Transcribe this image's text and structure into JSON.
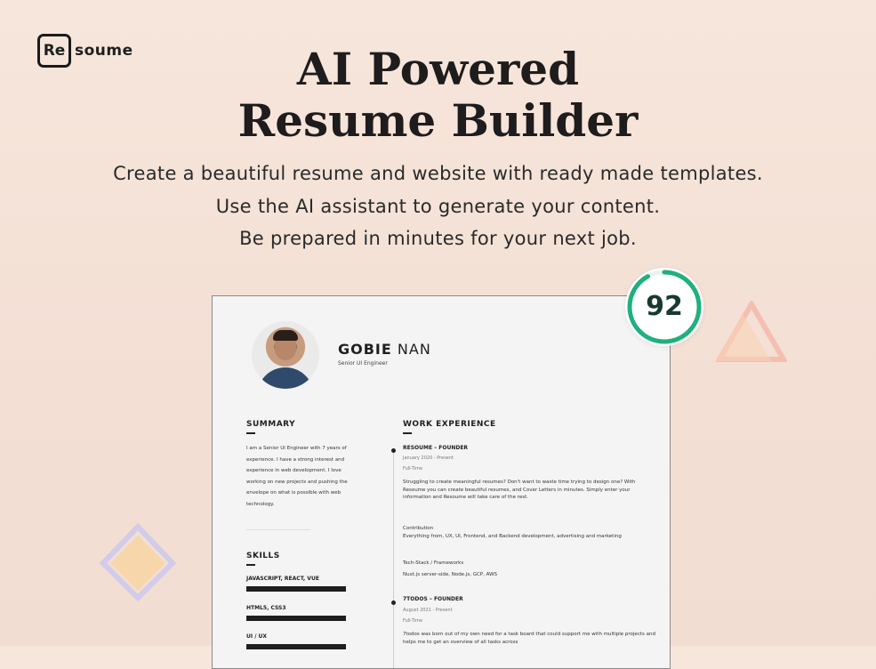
{
  "brand": {
    "logo_box": "Re",
    "logo_rest": "soume"
  },
  "hero": {
    "title_line1": "AI Powered",
    "title_line2": "Resume Builder",
    "sub_line1": "Create a beautiful resume and website with ready made templates.",
    "sub_line2": "Use the AI assistant to generate your content.",
    "sub_line3": "Be prepared in minutes for your next job."
  },
  "score": {
    "value": "92",
    "fraction": 0.92,
    "color": "#1fb07d"
  },
  "resume": {
    "first_name": "GOBIE",
    "last_name": " NAN",
    "role": "Senior UI Engineer",
    "summary_title": "SUMMARY",
    "summary_text": "I am a Senior UI Engineer with 7 years of experience. I have a strong interest and experience in web development. I love working on new projects and pushing the envelope on what is possible with web technology.",
    "skills_title": "SKILLS",
    "skills": [
      {
        "label": "JAVASCRIPT, REACT, VUE",
        "level": 0.9
      },
      {
        "label": "HTML5, CSS3",
        "level": 0.9
      },
      {
        "label": "UI / UX",
        "level": 0.9
      }
    ],
    "work_title": "WORK EXPERIENCE",
    "jobs": [
      {
        "title": "RESOUME – FOUNDER",
        "date": "January 2020 - Present",
        "type": "Full-Time",
        "description": "Struggling to create meaningful resumes? Don't want to waste time trying to design one? With Resoume you can create beautiful resumes, and Cover Letters in minutes. Simply enter your information and Resoume will take care of the rest.",
        "contribution_label": "Contribution",
        "contribution": "Everything from, UX, UI, Frontend, and Backend development, advertising and marketing",
        "stack_label": "Tech-Stack / Frameworks",
        "stack": "Nuxt.js server-side, Node.js, GCP, AWS"
      },
      {
        "title": "7TODOS – FOUNDER",
        "date": "August 2021 - Present",
        "type": "Full-Time",
        "description": "7todos was born out of my own need for a task board that could support me with multiple projects and helps me to get an overview of all tasks across"
      }
    ]
  }
}
